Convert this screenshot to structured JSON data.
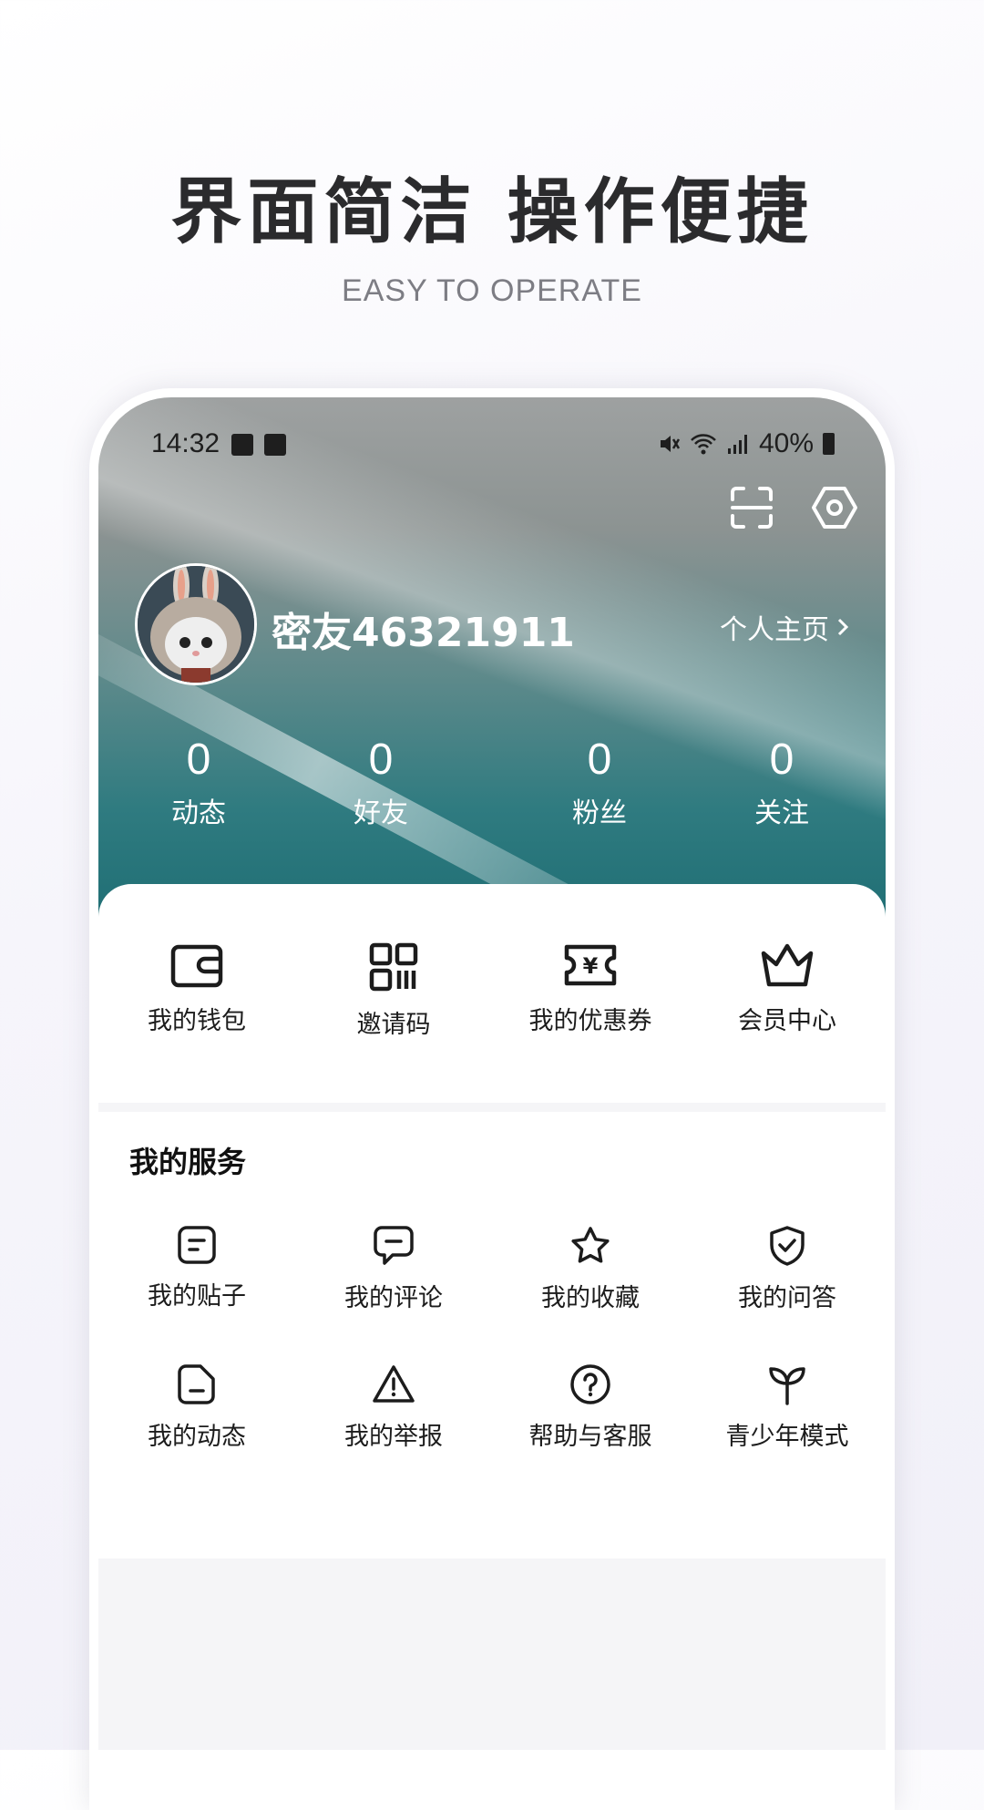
{
  "promo": {
    "title": "界面简洁  操作便捷",
    "subtitle": "EASY TO OPERATE"
  },
  "status_bar": {
    "time": "14:32",
    "battery": "40%"
  },
  "profile": {
    "username": "密友46321911",
    "homepage_link": "个人主页",
    "stats": [
      {
        "value": "0",
        "label": "动态"
      },
      {
        "value": "0",
        "label": "好友"
      },
      {
        "value": "0",
        "label": "粉丝"
      },
      {
        "value": "0",
        "label": "关注"
      }
    ]
  },
  "quick_actions": [
    {
      "label": "我的钱包",
      "icon": "wallet-icon"
    },
    {
      "label": "邀请码",
      "icon": "qr-code-icon"
    },
    {
      "label": "我的优惠券",
      "icon": "coupon-icon"
    },
    {
      "label": "会员中心",
      "icon": "crown-icon"
    }
  ],
  "services": {
    "title": "我的服务",
    "items": [
      {
        "label": "我的贴子",
        "icon": "post-icon"
      },
      {
        "label": "我的评论",
        "icon": "comment-icon"
      },
      {
        "label": "我的收藏",
        "icon": "star-icon"
      },
      {
        "label": "我的问答",
        "icon": "shield-check-icon"
      },
      {
        "label": "我的动态",
        "icon": "document-icon"
      },
      {
        "label": "我的举报",
        "icon": "warning-icon"
      },
      {
        "label": "帮助与客服",
        "icon": "help-icon"
      },
      {
        "label": "青少年模式",
        "icon": "sprout-icon"
      }
    ]
  }
}
